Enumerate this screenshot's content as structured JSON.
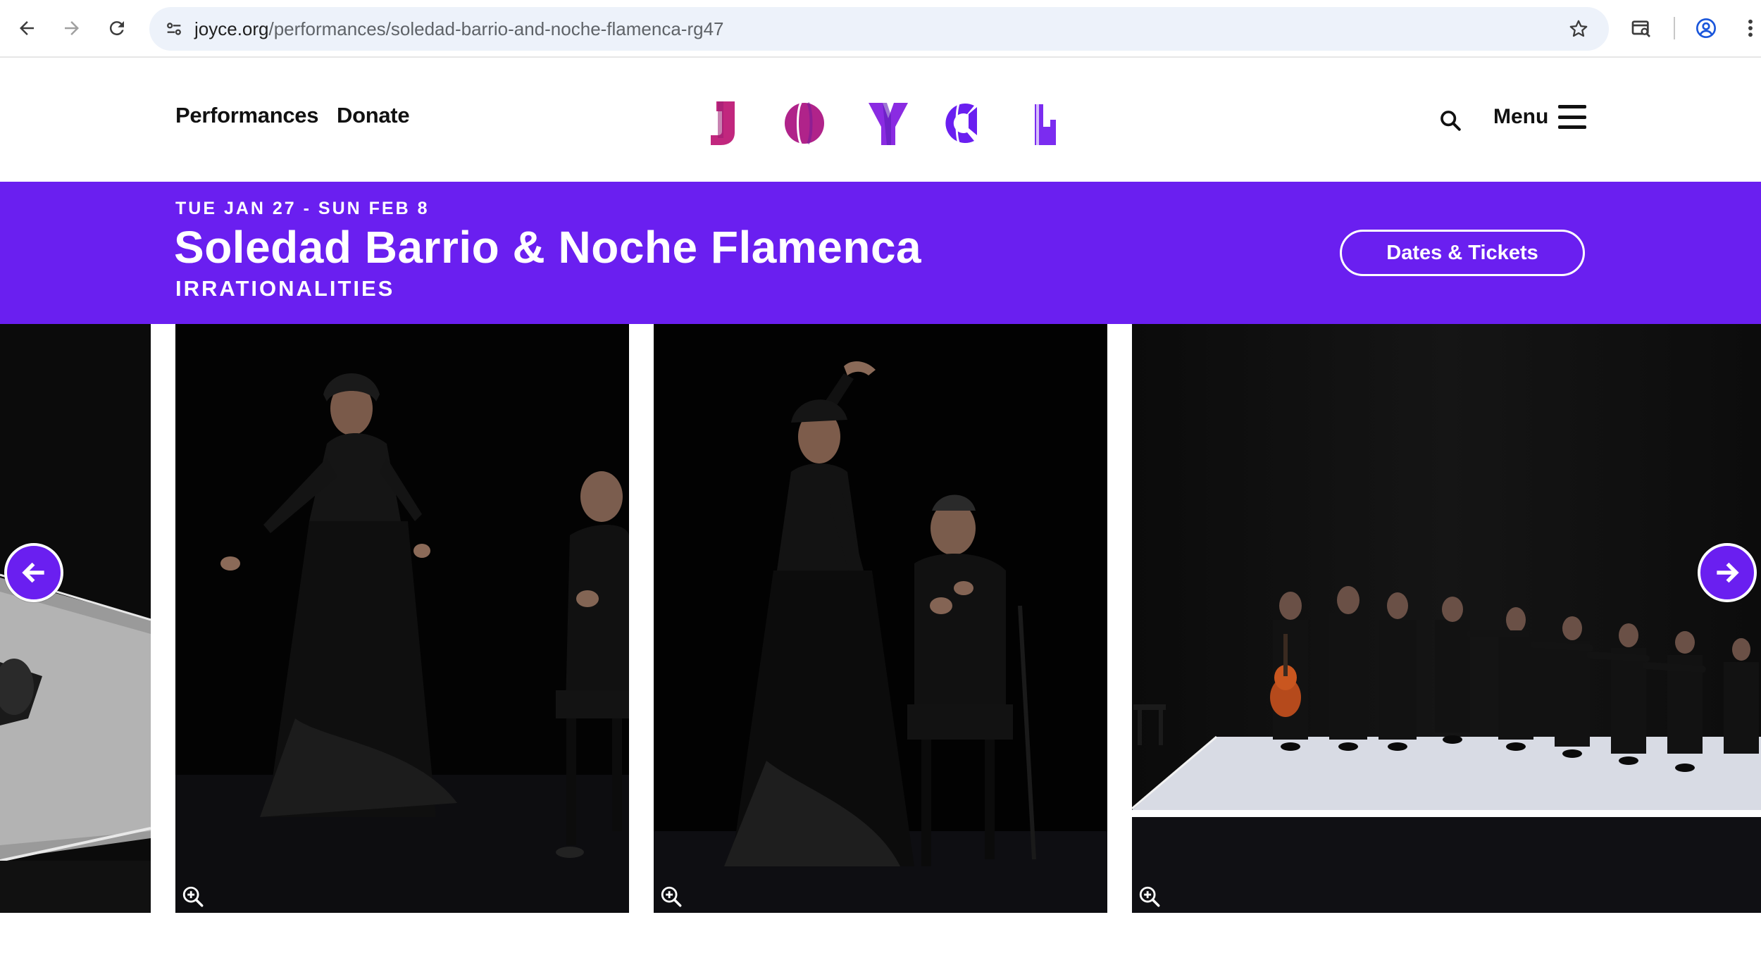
{
  "browser": {
    "url_host": "joyce.org",
    "url_path": "/performances/soledad-barrio-and-noche-flamenca-rg47"
  },
  "header": {
    "nav_performances": "Performances",
    "nav_donate": "Donate",
    "logo_letters": [
      "J",
      "O",
      "Y",
      "C",
      "E"
    ],
    "menu_label": "Menu"
  },
  "banner": {
    "dates": "TUE JAN 27 - SUN FEB 8",
    "title": "Soledad Barrio & Noche Flamenca",
    "subtitle": "IRRATIONALITIES",
    "tickets_label": "Dates & Tickets"
  },
  "gallery": {
    "photos": [
      {
        "icon": "zoom-in-icon"
      },
      {
        "icon": "zoom-in-icon"
      },
      {
        "icon": "zoom-in-icon"
      },
      {
        "icon": "zoom-in-icon"
      }
    ],
    "prev_icon": "arrow-left-icon",
    "next_icon": "arrow-right-icon"
  },
  "colors": {
    "brand_purple": "#6a1ff0",
    "logo_magenta": "#c1277e",
    "logo_violet": "#7b2cf0"
  }
}
